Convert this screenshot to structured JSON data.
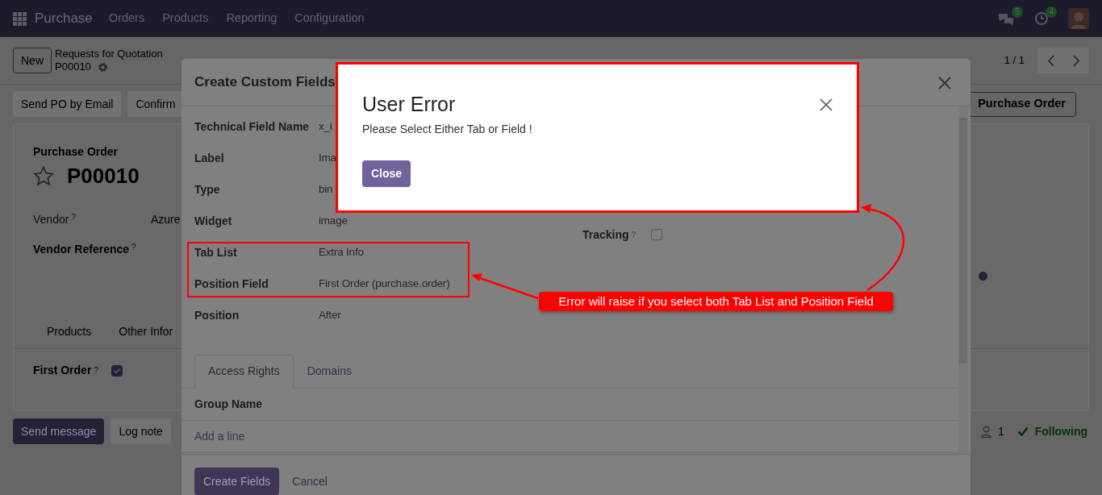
{
  "navbar": {
    "app": "Purchase",
    "menu": [
      "Orders",
      "Products",
      "Reporting",
      "Configuration"
    ],
    "messages_count": "5",
    "activities_count": "4"
  },
  "control_panel": {
    "new_button": "New",
    "breadcrumb": "Requests for Quotation",
    "record": "P00010",
    "pager": "1 / 1"
  },
  "action_buttons": [
    "Send PO by Email",
    "Confirm"
  ],
  "status_button": "Purchase Order",
  "sheet": {
    "subtitle": "Purchase Order",
    "title": "P00010",
    "starred": false,
    "fields": [
      {
        "label": "Vendor",
        "help": "?",
        "value": "Azure",
        "kind": "muted"
      },
      {
        "label": "Vendor Reference",
        "help": "?",
        "kind": "bold"
      }
    ],
    "tabs": [
      {
        "label": "Products",
        "selected": false
      },
      {
        "label": "Other Infor",
        "selected": false
      }
    ],
    "first_order": {
      "label": "First Order",
      "help": "?",
      "checked": true
    }
  },
  "chatter": {
    "buttons": [
      {
        "label": "Send message",
        "kind": "primary"
      },
      {
        "label": "Log note",
        "kind": "secondary"
      }
    ],
    "followers": "1",
    "following": "Following"
  },
  "modal": {
    "title": "Create Custom Fields",
    "fields": [
      {
        "label": "Technical Field Name",
        "value": "x_i"
      },
      {
        "label": "Label",
        "value": "Ima"
      },
      {
        "label": "Type",
        "value": "bin"
      },
      {
        "label": "Widget",
        "value": "image"
      },
      {
        "label": "Tab List",
        "value": "Extra Info"
      },
      {
        "label": "Position Field",
        "value": "First Order (purchase.order)"
      },
      {
        "label": "Position",
        "value": "After"
      }
    ],
    "tracking": {
      "label": "Tracking",
      "help": "?",
      "checked": false
    },
    "tabs": [
      {
        "label": "Access Rights",
        "selected": true
      },
      {
        "label": "Domains",
        "selected": false
      }
    ],
    "table": {
      "columns": [
        "Group Name"
      ],
      "add_line": "Add a line"
    },
    "buttons": [
      {
        "label": "Create Fields",
        "kind": "primary"
      },
      {
        "label": "Cancel",
        "kind": "link"
      }
    ]
  },
  "error_dialog": {
    "title": "User Error",
    "message": "Please Select Either Tab or Field !",
    "button": "Close"
  },
  "annotation": {
    "text": "Error will raise if you select both Tab List and Position Field"
  }
}
